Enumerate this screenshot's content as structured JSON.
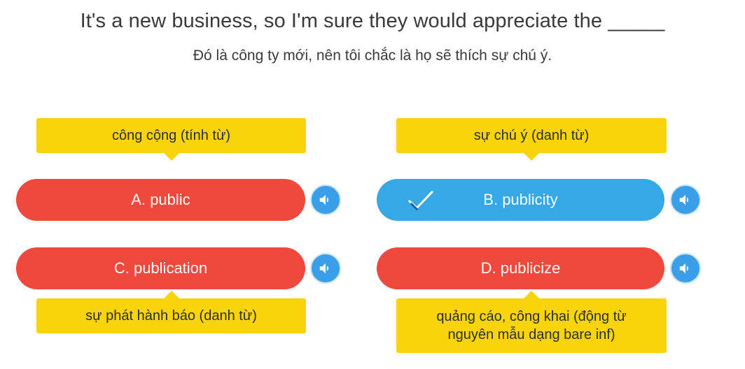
{
  "question": {
    "text": "It's a new business, so I'm sure they would appreciate the _____",
    "translation": "Đó là công ty mới, nên tôi chắc là họ sẽ thích sự chú ý."
  },
  "options": {
    "a": {
      "label": "A. public",
      "hint": "công cộng (tính từ)",
      "state": "wrong"
    },
    "b": {
      "label": "B. publicity",
      "hint": "sự chú ý (danh từ)",
      "state": "correct"
    },
    "c": {
      "label": "C. publication",
      "hint": "sự phát hành báo (danh từ)",
      "state": "wrong"
    },
    "d": {
      "label": "D. publicize",
      "hint_line1": "quảng cáo, công khai (động từ",
      "hint_line2": "nguyên mẫu dạng bare inf)",
      "state": "wrong"
    }
  },
  "icons": {
    "speaker": "speaker-icon",
    "check": "check-icon"
  },
  "colors": {
    "wrong": "#ef483d",
    "correct": "#36a8e6",
    "hint": "#f9d40b",
    "speaker": "#3a9ee8"
  }
}
